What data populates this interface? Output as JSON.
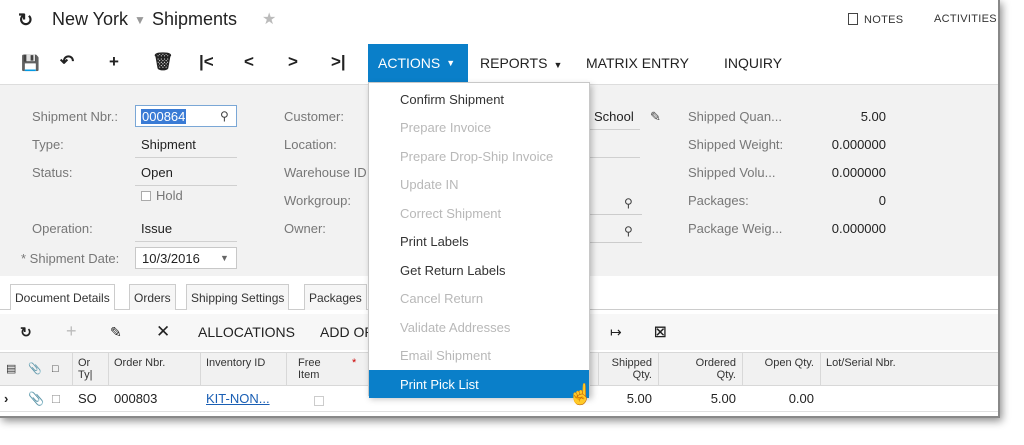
{
  "title": {
    "branch": "New York",
    "screen": "Shipments"
  },
  "header_links": {
    "notes": "NOTES",
    "activities": "ACTIVITIES"
  },
  "toolbar": {
    "actions": "ACTIONS",
    "reports": "REPORTS",
    "matrix_entry": "MATRIX ENTRY",
    "inquiry": "INQUIRY"
  },
  "form": {
    "shipment_nbr_label": "Shipment Nbr.:",
    "shipment_nbr": "000864",
    "type_label": "Type:",
    "type": "Shipment",
    "status_label": "Status:",
    "status": "Open",
    "hold_label": "Hold",
    "operation_label": "Operation:",
    "operation": "Issue",
    "shipment_date_label": "* Shipment Date:",
    "shipment_date": "10/3/2016",
    "customer_label": "Customer:",
    "customer_tail": "School",
    "location_label": "Location:",
    "warehouse_label": "Warehouse ID",
    "workgroup_label": "Workgroup:",
    "owner_label": "Owner:"
  },
  "summary": [
    {
      "label": "Shipped Quan...",
      "value": "5.00"
    },
    {
      "label": "Shipped Weight:",
      "value": "0.000000"
    },
    {
      "label": "Shipped Volu...",
      "value": "0.000000"
    },
    {
      "label": "Packages:",
      "value": "0"
    },
    {
      "label": "Package Weig...",
      "value": "0.000000"
    }
  ],
  "tabs": [
    "Document Details",
    "Orders",
    "Shipping Settings",
    "Packages"
  ],
  "grid_toolbar": {
    "allocations": "ALLOCATIONS",
    "add_order": "ADD OR"
  },
  "grid_headers": {
    "order_type": "Or Ty|",
    "order_nbr": "Order Nbr.",
    "inventory_id": "Inventory ID",
    "free_item": "Free Item",
    "shipped_qty": "Shipped Qty.",
    "ordered_qty": "Ordered Qty.",
    "open_qty": "Open Qty.",
    "lot_serial": "Lot/Serial Nbr."
  },
  "grid_row": {
    "order_type": "SO",
    "order_nbr": "000803",
    "inventory_id": "KIT-NON...",
    "shipped_qty": "5.00",
    "ordered_qty": "5.00",
    "open_qty": "0.00"
  },
  "actions_menu": [
    {
      "label": "Confirm Shipment",
      "enabled": true
    },
    {
      "label": "Prepare Invoice",
      "enabled": false
    },
    {
      "label": "Prepare Drop-Ship Invoice",
      "enabled": false
    },
    {
      "label": "Update IN",
      "enabled": false
    },
    {
      "label": "Correct Shipment",
      "enabled": false
    },
    {
      "label": "Print Labels",
      "enabled": true
    },
    {
      "label": "Get Return Labels",
      "enabled": true
    },
    {
      "label": "Cancel Return",
      "enabled": false
    },
    {
      "label": "Validate Addresses",
      "enabled": false
    },
    {
      "label": "Email Shipment",
      "enabled": false
    },
    {
      "label": "Print Pick List",
      "enabled": true,
      "selected": true
    }
  ],
  "colors": {
    "accent": "#0a7fc9",
    "form_bg": "#f2f2f2",
    "link": "#1a5fb4"
  }
}
